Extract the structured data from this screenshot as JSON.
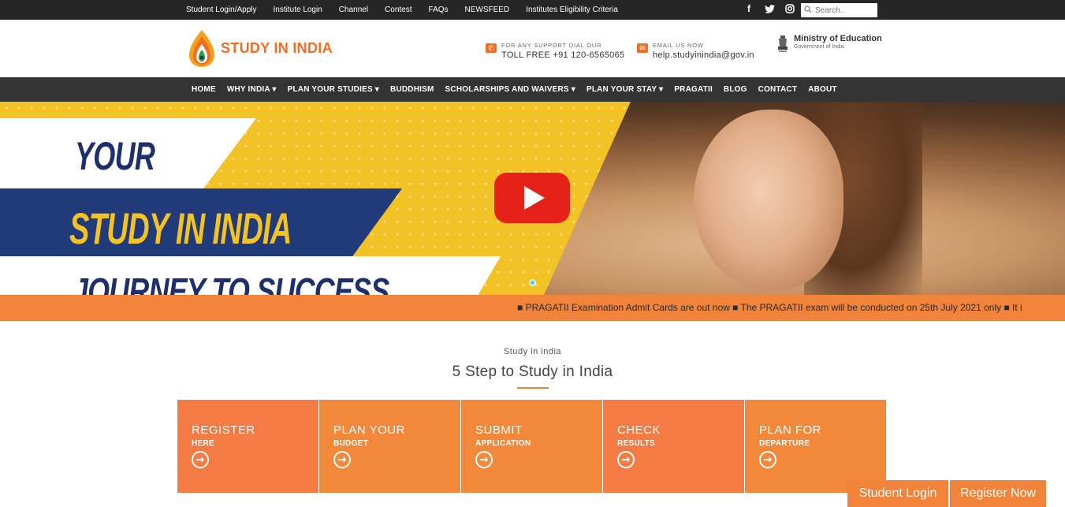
{
  "topbar": {
    "links": [
      "Student Login/Apply",
      "Institute Login",
      "Channel",
      "Contest",
      "FAQs",
      "NEWSFEED",
      "Institutes Eligibility Criteria"
    ],
    "social": {
      "facebook": "f"
    },
    "search_placeholder": "Search.."
  },
  "header": {
    "logo_text": "STUDY IN INDIA",
    "phone_label": "FOR ANY SUPPORT DIAL OUR",
    "phone_value": "TOLL FREE +91 120-6565065",
    "email_label": "EMAIL US NOW",
    "email_value": "help.studyinindia@gov.in",
    "ministry_title": "Ministry of Education",
    "ministry_sub": "Government of India"
  },
  "nav": [
    "HOME",
    "WHY INDIA ▾",
    "PLAN YOUR STUDIES ▾",
    "BUDDHISM",
    "SCHOLARSHIPS AND WAIVERS ▾",
    "PLAN YOUR STAY ▾",
    "PRAGATII",
    "BLOG",
    "CONTACT",
    "ABOUT"
  ],
  "hero": {
    "line1": "YOUR",
    "line2": "STUDY IN INDIA",
    "line3": "JOURNEY TO SUCCESS"
  },
  "ticker": "■ PRAGATII Examination Admit Cards are out now ■ The PRAGATII exam will be conducted on 25th July 2021 only ■ It i",
  "section": {
    "subtitle": "Study in india",
    "title": "5 Step to Study in India"
  },
  "steps": [
    {
      "l1": "REGISTER",
      "l2": "HERE",
      "color": "#f47c44"
    },
    {
      "l1": "PLAN YOUR",
      "l2": "BUDGET",
      "color": "#f1883a"
    },
    {
      "l1": "SUBMIT",
      "l2": "APPLICATION",
      "color": "#f1883a"
    },
    {
      "l1": "CHECK",
      "l2": "RESULTS",
      "color": "#f47c44"
    },
    {
      "l1": "PLAN FOR",
      "l2": "DEPARTURE",
      "color": "#f1883a"
    }
  ],
  "arrow_glyph": "➞",
  "floating": {
    "login": "Student Login",
    "register": "Register Now"
  },
  "colors": {
    "accent": "#f1833b",
    "navy": "#1d2f6c",
    "yellow": "#f3c224",
    "dark": "#262626"
  }
}
